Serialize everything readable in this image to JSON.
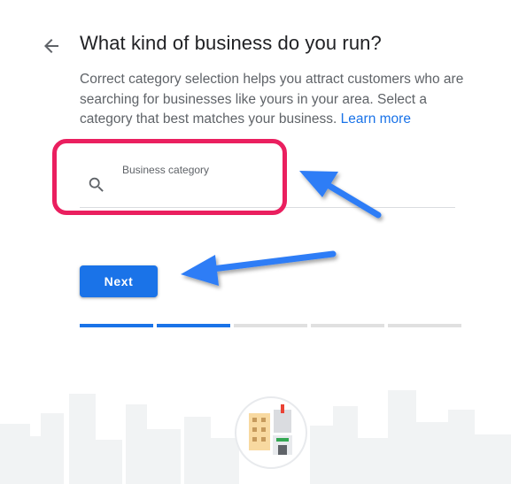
{
  "header": {
    "back_icon": "arrow-left-icon",
    "title": "What kind of business do you run?",
    "subtitle": "Correct category selection helps you attract customers who are searching for businesses like yours in your area. Select a category that best matches your business.",
    "learn_more_label": "Learn more"
  },
  "category_field": {
    "label": "Business category",
    "value": "",
    "icon": "search-icon"
  },
  "next_button": {
    "label": "Next"
  },
  "progress": {
    "total_steps": 5,
    "completed_steps": 2
  },
  "colors": {
    "primary": "#1a73e8",
    "highlight_box": "#ea1f5f",
    "annotation_arrow": "#2f7df6",
    "title_text": "#202124",
    "body_text": "#5f6368"
  }
}
